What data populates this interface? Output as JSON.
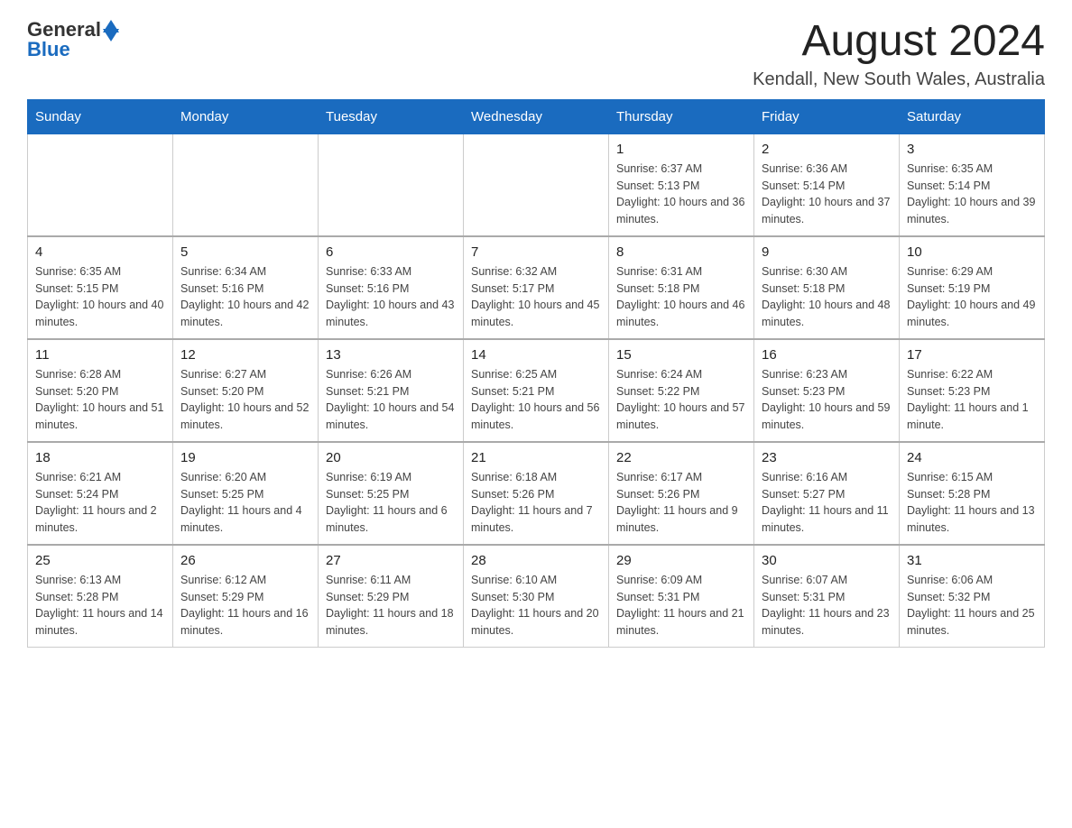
{
  "header": {
    "logo_general": "General",
    "logo_blue": "Blue",
    "month_year": "August 2024",
    "location": "Kendall, New South Wales, Australia"
  },
  "days_of_week": [
    "Sunday",
    "Monday",
    "Tuesday",
    "Wednesday",
    "Thursday",
    "Friday",
    "Saturday"
  ],
  "weeks": [
    [
      {
        "day": "",
        "info": ""
      },
      {
        "day": "",
        "info": ""
      },
      {
        "day": "",
        "info": ""
      },
      {
        "day": "",
        "info": ""
      },
      {
        "day": "1",
        "info": "Sunrise: 6:37 AM\nSunset: 5:13 PM\nDaylight: 10 hours and 36 minutes."
      },
      {
        "day": "2",
        "info": "Sunrise: 6:36 AM\nSunset: 5:14 PM\nDaylight: 10 hours and 37 minutes."
      },
      {
        "day": "3",
        "info": "Sunrise: 6:35 AM\nSunset: 5:14 PM\nDaylight: 10 hours and 39 minutes."
      }
    ],
    [
      {
        "day": "4",
        "info": "Sunrise: 6:35 AM\nSunset: 5:15 PM\nDaylight: 10 hours and 40 minutes."
      },
      {
        "day": "5",
        "info": "Sunrise: 6:34 AM\nSunset: 5:16 PM\nDaylight: 10 hours and 42 minutes."
      },
      {
        "day": "6",
        "info": "Sunrise: 6:33 AM\nSunset: 5:16 PM\nDaylight: 10 hours and 43 minutes."
      },
      {
        "day": "7",
        "info": "Sunrise: 6:32 AM\nSunset: 5:17 PM\nDaylight: 10 hours and 45 minutes."
      },
      {
        "day": "8",
        "info": "Sunrise: 6:31 AM\nSunset: 5:18 PM\nDaylight: 10 hours and 46 minutes."
      },
      {
        "day": "9",
        "info": "Sunrise: 6:30 AM\nSunset: 5:18 PM\nDaylight: 10 hours and 48 minutes."
      },
      {
        "day": "10",
        "info": "Sunrise: 6:29 AM\nSunset: 5:19 PM\nDaylight: 10 hours and 49 minutes."
      }
    ],
    [
      {
        "day": "11",
        "info": "Sunrise: 6:28 AM\nSunset: 5:20 PM\nDaylight: 10 hours and 51 minutes."
      },
      {
        "day": "12",
        "info": "Sunrise: 6:27 AM\nSunset: 5:20 PM\nDaylight: 10 hours and 52 minutes."
      },
      {
        "day": "13",
        "info": "Sunrise: 6:26 AM\nSunset: 5:21 PM\nDaylight: 10 hours and 54 minutes."
      },
      {
        "day": "14",
        "info": "Sunrise: 6:25 AM\nSunset: 5:21 PM\nDaylight: 10 hours and 56 minutes."
      },
      {
        "day": "15",
        "info": "Sunrise: 6:24 AM\nSunset: 5:22 PM\nDaylight: 10 hours and 57 minutes."
      },
      {
        "day": "16",
        "info": "Sunrise: 6:23 AM\nSunset: 5:23 PM\nDaylight: 10 hours and 59 minutes."
      },
      {
        "day": "17",
        "info": "Sunrise: 6:22 AM\nSunset: 5:23 PM\nDaylight: 11 hours and 1 minute."
      }
    ],
    [
      {
        "day": "18",
        "info": "Sunrise: 6:21 AM\nSunset: 5:24 PM\nDaylight: 11 hours and 2 minutes."
      },
      {
        "day": "19",
        "info": "Sunrise: 6:20 AM\nSunset: 5:25 PM\nDaylight: 11 hours and 4 minutes."
      },
      {
        "day": "20",
        "info": "Sunrise: 6:19 AM\nSunset: 5:25 PM\nDaylight: 11 hours and 6 minutes."
      },
      {
        "day": "21",
        "info": "Sunrise: 6:18 AM\nSunset: 5:26 PM\nDaylight: 11 hours and 7 minutes."
      },
      {
        "day": "22",
        "info": "Sunrise: 6:17 AM\nSunset: 5:26 PM\nDaylight: 11 hours and 9 minutes."
      },
      {
        "day": "23",
        "info": "Sunrise: 6:16 AM\nSunset: 5:27 PM\nDaylight: 11 hours and 11 minutes."
      },
      {
        "day": "24",
        "info": "Sunrise: 6:15 AM\nSunset: 5:28 PM\nDaylight: 11 hours and 13 minutes."
      }
    ],
    [
      {
        "day": "25",
        "info": "Sunrise: 6:13 AM\nSunset: 5:28 PM\nDaylight: 11 hours and 14 minutes."
      },
      {
        "day": "26",
        "info": "Sunrise: 6:12 AM\nSunset: 5:29 PM\nDaylight: 11 hours and 16 minutes."
      },
      {
        "day": "27",
        "info": "Sunrise: 6:11 AM\nSunset: 5:29 PM\nDaylight: 11 hours and 18 minutes."
      },
      {
        "day": "28",
        "info": "Sunrise: 6:10 AM\nSunset: 5:30 PM\nDaylight: 11 hours and 20 minutes."
      },
      {
        "day": "29",
        "info": "Sunrise: 6:09 AM\nSunset: 5:31 PM\nDaylight: 11 hours and 21 minutes."
      },
      {
        "day": "30",
        "info": "Sunrise: 6:07 AM\nSunset: 5:31 PM\nDaylight: 11 hours and 23 minutes."
      },
      {
        "day": "31",
        "info": "Sunrise: 6:06 AM\nSunset: 5:32 PM\nDaylight: 11 hours and 25 minutes."
      }
    ]
  ]
}
